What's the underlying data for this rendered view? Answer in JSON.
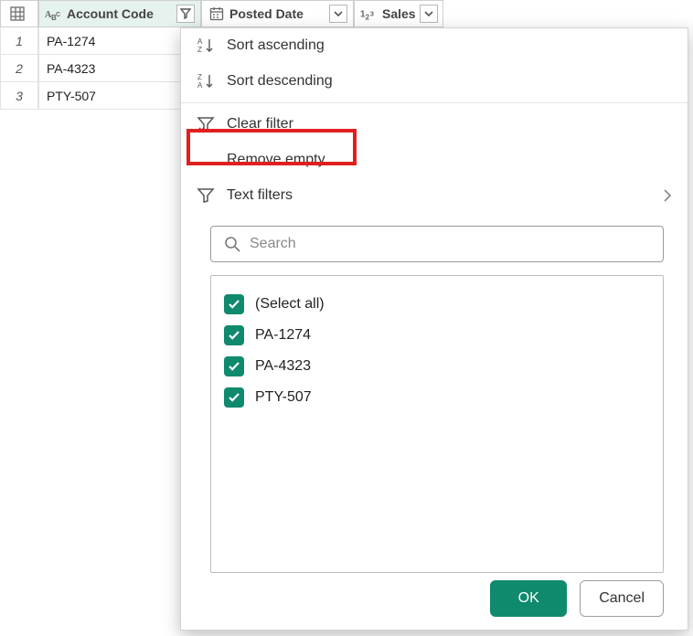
{
  "columns": {
    "account_code": {
      "label": "Account Code"
    },
    "posted_date": {
      "label": "Posted Date"
    },
    "sales": {
      "label": "Sales"
    }
  },
  "rows": [
    {
      "n": "1",
      "account_code": "PA-1274"
    },
    {
      "n": "2",
      "account_code": "PA-4323"
    },
    {
      "n": "3",
      "account_code": "PTY-507"
    }
  ],
  "menu": {
    "sort_asc": "Sort ascending",
    "sort_desc": "Sort descending",
    "clear": "Clear filter",
    "remove_empty": "Remove empty",
    "text_filters": "Text filters"
  },
  "search": {
    "placeholder": "Search"
  },
  "checks": {
    "select_all": "(Select all)",
    "items": [
      "PA-1274",
      "PA-4323",
      "PTY-507"
    ]
  },
  "buttons": {
    "ok": "OK",
    "cancel": "Cancel"
  },
  "colors": {
    "accent": "#0f8a6c",
    "highlight": "#e02020"
  }
}
